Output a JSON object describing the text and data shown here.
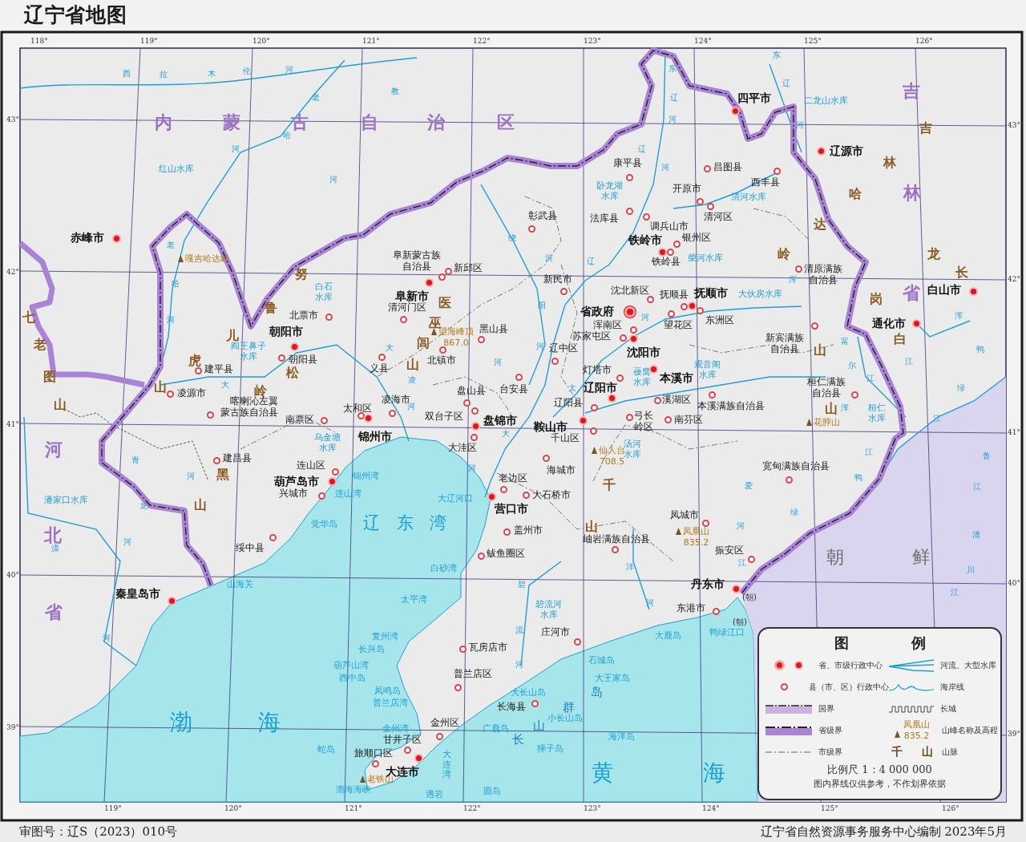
{
  "title": "辽宁省地图",
  "graticule": {
    "top": [
      "118°",
      "119°",
      "120°",
      "121°",
      "122°",
      "123°",
      "124°",
      "125°",
      "126°"
    ],
    "bottom": [
      "119°",
      "120°",
      "121°",
      "122°",
      "123°",
      "124°",
      "125°",
      "126°"
    ],
    "left": [
      "43°",
      "42°",
      "41°",
      "40°",
      "39°"
    ],
    "right": [
      "43°",
      "42°",
      "41°",
      "40°",
      "39°"
    ]
  },
  "regions": [
    "内",
    "蒙",
    "古",
    "自",
    "治",
    "区",
    "吉",
    "林",
    "省",
    "河",
    "北",
    "省"
  ],
  "neighbors": [
    {
      "text": "朝",
      "kind": "country"
    },
    {
      "text": "鲜",
      "kind": "country"
    },
    {
      "text": "(朝)",
      "kind": "note"
    },
    {
      "text": "(朝)",
      "kind": "note"
    }
  ],
  "ranges": [
    "努",
    "鲁",
    "儿",
    "虎",
    "山",
    "医",
    "巫",
    "闾",
    "山",
    "松",
    "岭",
    "黑",
    "山",
    "七",
    "老",
    "图",
    "山",
    "吉",
    "林",
    "哈",
    "达",
    "岭",
    "长",
    "龙",
    "岗",
    "白",
    "山",
    "千",
    "山",
    "山"
  ],
  "seas": [
    "渤",
    "海",
    "黄",
    "海"
  ],
  "bays": [
    "辽",
    "东",
    "湾"
  ],
  "archipelago": [
    "长",
    "山",
    "群",
    "岛"
  ],
  "water_labels": [
    "红山水库",
    "白石水库",
    "阎王鼻子水库",
    "乌金塘水库",
    "卧龙湖水库",
    "清河水库",
    "柴河水库",
    "大伙房水库",
    "葠窝水库",
    "观音阁水库",
    "桓仁水库",
    "汤河水库",
    "碧流河水库",
    "二龙山水库",
    "潘家口水库",
    "锦州湾",
    "连山湾",
    "觉华岛",
    "大辽河口",
    "白砂湾",
    "太平湾",
    "复州湾",
    "长兴岛",
    "葫芦山湾",
    "西中岛",
    "凤鸣岛",
    "普兰店湾",
    "金州湾",
    "大连湾",
    "渤海海峡",
    "蛇岛",
    "遇岩",
    "圆岛",
    "石城岛",
    "大王家岛",
    "大长山岛",
    "小长山岛",
    "广鹿岛",
    "獐子岛",
    "海洋岛",
    "大鹿岛",
    "鸭绿江口",
    "山海关"
  ],
  "river_labels": [
    "西",
    "拉",
    "木",
    "伦",
    "河",
    "老",
    "哈",
    "河",
    "河",
    "老",
    "哈",
    "河",
    "大",
    "教",
    "绕",
    "河",
    "阳",
    "河",
    "辽",
    "大",
    "凌",
    "河",
    "河",
    "太",
    "河",
    "东",
    "辽",
    "河",
    "辽",
    "河",
    "东",
    "辽",
    "河",
    "浑",
    "富",
    "尔",
    "江",
    "浑",
    "浑",
    "江",
    "鸭",
    "绿",
    "江",
    "鸭",
    "绿",
    "江",
    "爱",
    "河",
    "江",
    "清",
    "川",
    "江",
    "鲁",
    "江",
    "青",
    "河",
    "龙",
    "河",
    "滦",
    "河",
    "大",
    "河",
    "碧",
    "流",
    "河",
    "洋",
    "河"
  ],
  "peaks": [
    {
      "name": "嘎吉哈达岭"
    },
    {
      "name": "望海峰顶",
      "elevation": "867.0"
    },
    {
      "name": "仙人台",
      "elevation": "708.5"
    },
    {
      "name": "凤凰山",
      "elevation": "835.2"
    },
    {
      "name": "花脖山"
    },
    {
      "name": "老铁山"
    }
  ],
  "places": [
    {
      "text": "赤峰市",
      "kind": "city"
    },
    {
      "text": "四平市",
      "kind": "city"
    },
    {
      "text": "辽源市",
      "kind": "city"
    },
    {
      "text": "白山市",
      "kind": "city"
    },
    {
      "text": "通化市",
      "kind": "city"
    },
    {
      "text": "秦皇岛市",
      "kind": "city"
    },
    {
      "text": "康平县",
      "kind": "county"
    },
    {
      "text": "昌图县",
      "kind": "county"
    },
    {
      "text": "西丰县",
      "kind": "county"
    },
    {
      "text": "开原市",
      "kind": "county"
    },
    {
      "text": "彰武县",
      "kind": "county"
    },
    {
      "text": "法库县",
      "kind": "county"
    },
    {
      "text": "清河区",
      "kind": "county"
    },
    {
      "text": "调兵山市",
      "kind": "county"
    },
    {
      "text": "铁岭市",
      "kind": "city"
    },
    {
      "text": "银州区",
      "kind": "county"
    },
    {
      "text": "铁岭县",
      "kind": "county"
    },
    {
      "text": "阜新蒙古族自治县",
      "kind": "county"
    },
    {
      "text": "新邱区",
      "kind": "county"
    },
    {
      "text": "阜新市",
      "kind": "city"
    },
    {
      "text": "北票市",
      "kind": "county"
    },
    {
      "text": "清河门区",
      "kind": "county"
    },
    {
      "text": "朝阳市",
      "kind": "city"
    },
    {
      "text": "朝阳县",
      "kind": "county"
    },
    {
      "text": "建平县",
      "kind": "county"
    },
    {
      "text": "凌源市",
      "kind": "county"
    },
    {
      "text": "喀喇沁左翼蒙古族自治县",
      "kind": "county"
    },
    {
      "text": "南票区",
      "kind": "county"
    },
    {
      "text": "义县",
      "kind": "county"
    },
    {
      "text": "北镇市",
      "kind": "county"
    },
    {
      "text": "黑山县",
      "kind": "county"
    },
    {
      "text": "新民市",
      "kind": "county"
    },
    {
      "text": "沈北新区",
      "kind": "county"
    },
    {
      "text": "抚顺县",
      "kind": "county"
    },
    {
      "text": "抚顺市",
      "kind": "city"
    },
    {
      "text": "东洲区",
      "kind": "county"
    },
    {
      "text": "望花区",
      "kind": "county"
    },
    {
      "text": "省政府",
      "kind": "capital"
    },
    {
      "text": "浑南区",
      "kind": "county"
    },
    {
      "text": "苏家屯区",
      "kind": "county"
    },
    {
      "text": "辽中区",
      "kind": "county"
    },
    {
      "text": "沈阳市",
      "kind": "city"
    },
    {
      "text": "灯塔市",
      "kind": "county"
    },
    {
      "text": "本溪市",
      "kind": "city"
    },
    {
      "text": "辽阳市",
      "kind": "city"
    },
    {
      "text": "溪湖区",
      "kind": "county"
    },
    {
      "text": "本溪满族自治县",
      "kind": "county"
    },
    {
      "text": "南芬区",
      "kind": "county"
    },
    {
      "text": "桓仁满族自治县",
      "kind": "county"
    },
    {
      "text": "新宾满族自治县",
      "kind": "county"
    },
    {
      "text": "清原满族自治县",
      "kind": "county"
    },
    {
      "text": "宽甸满族自治县",
      "kind": "county"
    },
    {
      "text": "盘山县",
      "kind": "county"
    },
    {
      "text": "台安县",
      "kind": "county"
    },
    {
      "text": "辽阳县",
      "kind": "county"
    },
    {
      "text": "弓长岭区",
      "kind": "county"
    },
    {
      "text": "凌海市",
      "kind": "county"
    },
    {
      "text": "太和区",
      "kind": "county"
    },
    {
      "text": "锦州市",
      "kind": "city"
    },
    {
      "text": "双台子区",
      "kind": "county"
    },
    {
      "text": "盘锦市",
      "kind": "city"
    },
    {
      "text": "鞍山市",
      "kind": "city"
    },
    {
      "text": "千山区",
      "kind": "county"
    },
    {
      "text": "大洼区",
      "kind": "county"
    },
    {
      "text": "连山区",
      "kind": "county"
    },
    {
      "text": "葫芦岛市",
      "kind": "city"
    },
    {
      "text": "兴城市",
      "kind": "county"
    },
    {
      "text": "建昌县",
      "kind": "county"
    },
    {
      "text": "绥中县",
      "kind": "county"
    },
    {
      "text": "海城市",
      "kind": "county"
    },
    {
      "text": "老边区",
      "kind": "county"
    },
    {
      "text": "营口市",
      "kind": "city"
    },
    {
      "text": "大石桥市",
      "kind": "county"
    },
    {
      "text": "盖州市",
      "kind": "county"
    },
    {
      "text": "鲅鱼圈区",
      "kind": "county"
    },
    {
      "text": "岫岩满族自治县",
      "kind": "county"
    },
    {
      "text": "凤城市",
      "kind": "county"
    },
    {
      "text": "振安区",
      "kind": "county"
    },
    {
      "text": "丹东市",
      "kind": "city"
    },
    {
      "text": "东港市",
      "kind": "county"
    },
    {
      "text": "庄河市",
      "kind": "county"
    },
    {
      "text": "瓦房店市",
      "kind": "county"
    },
    {
      "text": "普兰店区",
      "kind": "county"
    },
    {
      "text": "长海县",
      "kind": "county"
    },
    {
      "text": "金州区",
      "kind": "county"
    },
    {
      "text": "甘井子区",
      "kind": "county"
    },
    {
      "text": "旅顺口区",
      "kind": "county"
    },
    {
      "text": "大连市",
      "kind": "city"
    }
  ],
  "legend": {
    "title": [
      "图",
      "例"
    ],
    "items": [
      {
        "kind": "province_center",
        "label": "省、市级行政中心"
      },
      {
        "kind": "river",
        "label": "河流、大型水库"
      },
      {
        "kind": "county_center",
        "label": "县（市、区）行政中心"
      },
      {
        "kind": "coastline",
        "label": "海岸线"
      },
      {
        "kind": "national_border",
        "label": "国界"
      },
      {
        "kind": "great_wall",
        "label": "长城"
      },
      {
        "kind": "provincial_border",
        "label": "省级界"
      },
      {
        "kind": "peak",
        "label": "山峰名称及高程",
        "sample": [
          "凤凰山",
          "835.2"
        ]
      },
      {
        "kind": "city_border",
        "label": "市级界"
      },
      {
        "kind": "range",
        "label": "山脉",
        "sample": [
          "千",
          "山"
        ]
      }
    ],
    "scale": "比例尺 1：4 000 000",
    "note": "图内界线仅供参考，不作划界依据"
  },
  "footer": {
    "approval": "审图号：辽S（2023）010号",
    "publisher": "辽宁省自然资源事务服务中心编制 2023年5月"
  }
}
